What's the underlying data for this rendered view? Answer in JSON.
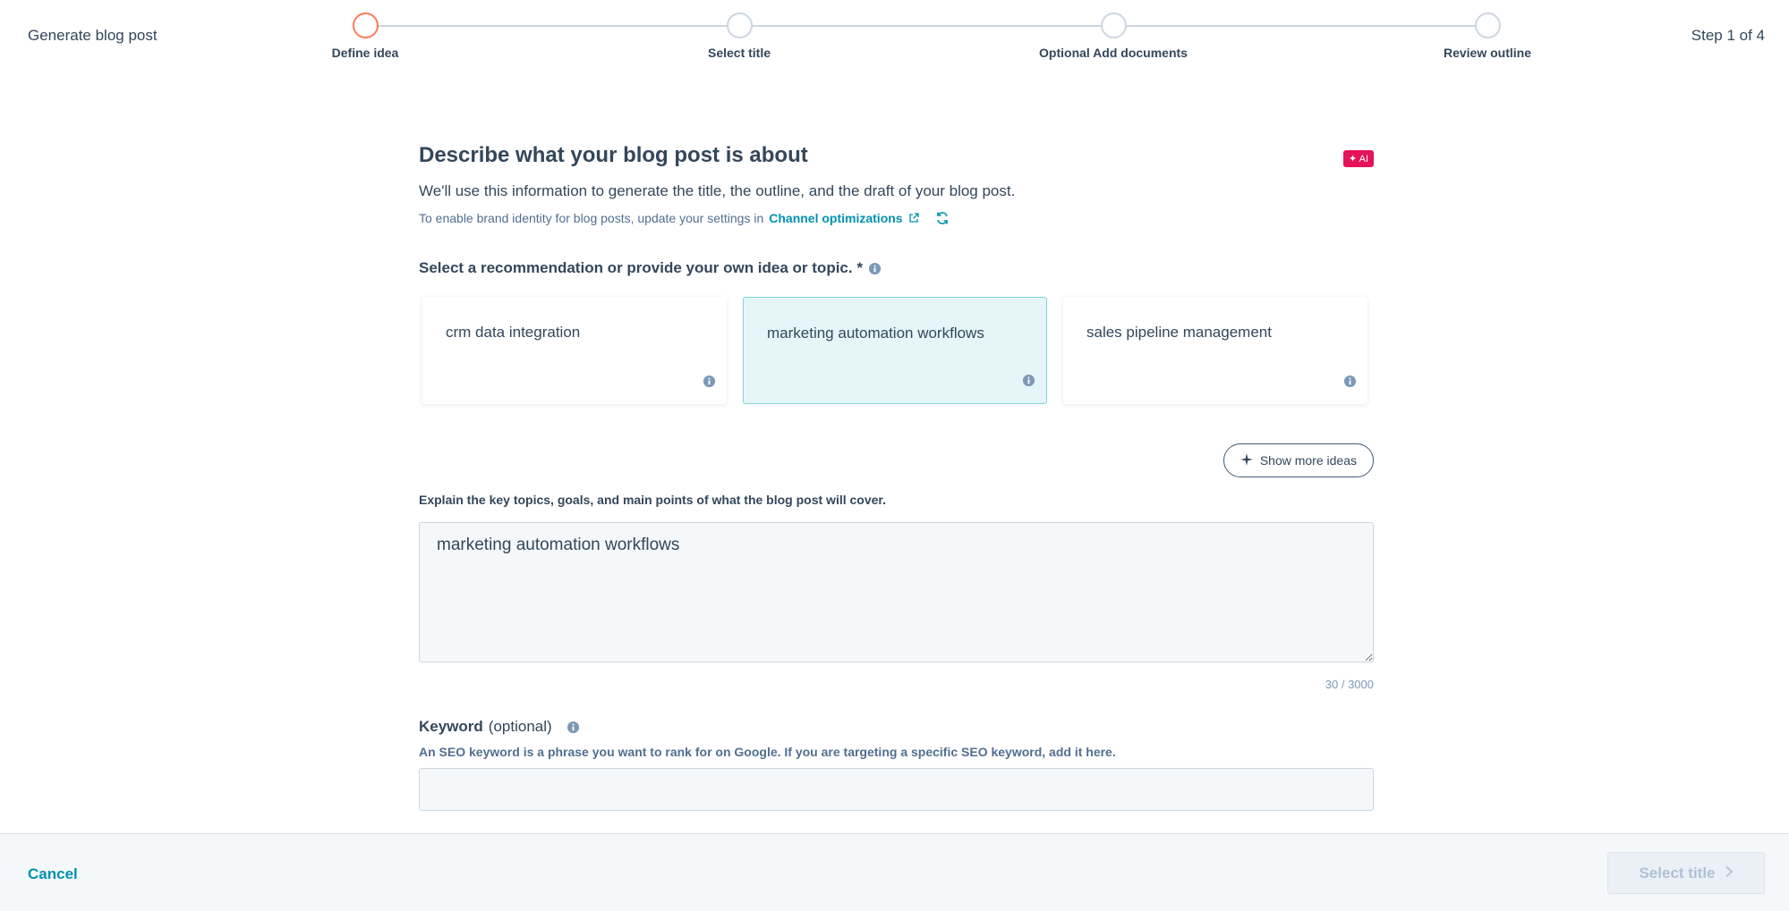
{
  "header": {
    "title": "Generate blog post",
    "step_count": "Step 1 of 4",
    "steps": [
      {
        "label": "Define idea"
      },
      {
        "label": "Select title"
      },
      {
        "label": "Optional Add documents"
      },
      {
        "label": "Review outline"
      }
    ]
  },
  "main": {
    "heading": "Describe what your blog post is about",
    "ai_badge": "✦ AI",
    "subtitle": "We'll use this information to generate the title, the outline, and the draft of your blog post.",
    "brand_note_prefix": "To enable brand identity for blog posts, update your settings in",
    "brand_note_link": "Channel optimizations",
    "recommend_label": "Select a recommendation or provide your own idea or topic. *",
    "cards": [
      {
        "label": "crm data integration"
      },
      {
        "label": "marketing automation workflows"
      },
      {
        "label": "sales pipeline management"
      }
    ],
    "show_more_label": "Show more ideas",
    "explain_label": "Explain the key topics, goals, and main points of what the blog post will cover.",
    "explain_value": "marketing automation workflows",
    "char_count": "30 / 3000",
    "keyword_label": "Keyword",
    "keyword_optional": "(optional)",
    "seo_help": "An SEO keyword is a phrase you want to rank for on Google. If you are targeting a specific SEO keyword, add it here.",
    "keyword_value": ""
  },
  "footer": {
    "cancel_label": "Cancel",
    "next_label": "Select title"
  },
  "colors": {
    "accent": "#0091ae",
    "active_step": "#ff7a59",
    "ai_badge": "#e5135a"
  }
}
